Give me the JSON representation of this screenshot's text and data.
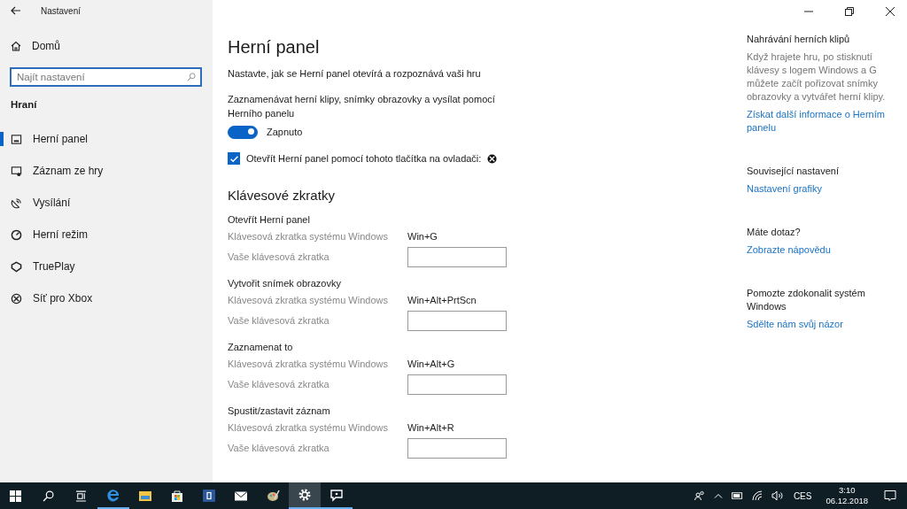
{
  "window": {
    "title": "Nastavení"
  },
  "sidebar": {
    "home": "Domů",
    "search": {
      "placeholder": "Najít nastavení"
    },
    "section": "Hraní",
    "items": [
      {
        "label": "Herní panel",
        "selected": true
      },
      {
        "label": "Záznam ze hry",
        "selected": false
      },
      {
        "label": "Vysílání",
        "selected": false
      },
      {
        "label": "Herní režim",
        "selected": false
      },
      {
        "label": "TruePlay",
        "selected": false
      },
      {
        "label": "Síť pro Xbox",
        "selected": false
      }
    ]
  },
  "main": {
    "title": "Herní panel",
    "subtitle": "Nastavte, jak se Herní panel otevírá a rozpoznává vaši hru",
    "toggle": {
      "label": "Zaznamenávat herní klipy, snímky obrazovky a vysílat pomocí Herního panelu",
      "on": true,
      "state_text": "Zapnuto"
    },
    "checkbox": {
      "label": "Otevřít Herní panel pomocí tohoto tlačítka na ovladači:",
      "checked": true
    },
    "shortcuts_heading": "Klávesové zkratky",
    "shortcuts": [
      {
        "title": "Otevřít Herní panel",
        "system_label": "Klávesová zkratka systému Windows",
        "system_value": "Win+G",
        "custom_label": "Vaše klávesová zkratka"
      },
      {
        "title": "Vytvořit snímek obrazovky",
        "system_label": "Klávesová zkratka systému Windows",
        "system_value": "Win+Alt+PrtScn",
        "custom_label": "Vaše klávesová zkratka"
      },
      {
        "title": "Zaznamenat to",
        "system_label": "Klávesová zkratka systému Windows",
        "system_value": "Win+Alt+G",
        "custom_label": "Vaše klávesová zkratka"
      },
      {
        "title": "Spustit/zastavit záznam",
        "system_label": "Klávesová zkratka systému Windows",
        "system_value": "Win+Alt+R",
        "custom_label": "Vaše klávesová zkratka"
      }
    ]
  },
  "aside": [
    {
      "heading": "Nahrávání herních klipů",
      "text": "Když hrajete hru, po stisknutí klávesy s logem Windows a G můžete začít pořizovat snímky obrazovky a vytvářet herní klipy.",
      "link": "Získat další informace o Herním panelu"
    },
    {
      "heading": "Související nastavení",
      "link": "Nastavení grafiky"
    },
    {
      "heading": "Máte dotaz?",
      "link": "Zobrazte nápovědu"
    },
    {
      "heading": "Pomozte zdokonalit systém Windows",
      "link": "Sdělte nám svůj názor"
    }
  ],
  "taskbar": {
    "apps": [
      {
        "selected": false,
        "running": true
      },
      {
        "selected": false,
        "running": false
      },
      {
        "selected": false,
        "running": false
      },
      {
        "selected": false,
        "running": false
      },
      {
        "selected": false,
        "running": false
      },
      {
        "selected": false,
        "running": false
      },
      {
        "selected": true,
        "running": true
      },
      {
        "selected": false,
        "running": true
      }
    ],
    "language": "CES",
    "time": "3:10",
    "date": "06.12.2018"
  }
}
